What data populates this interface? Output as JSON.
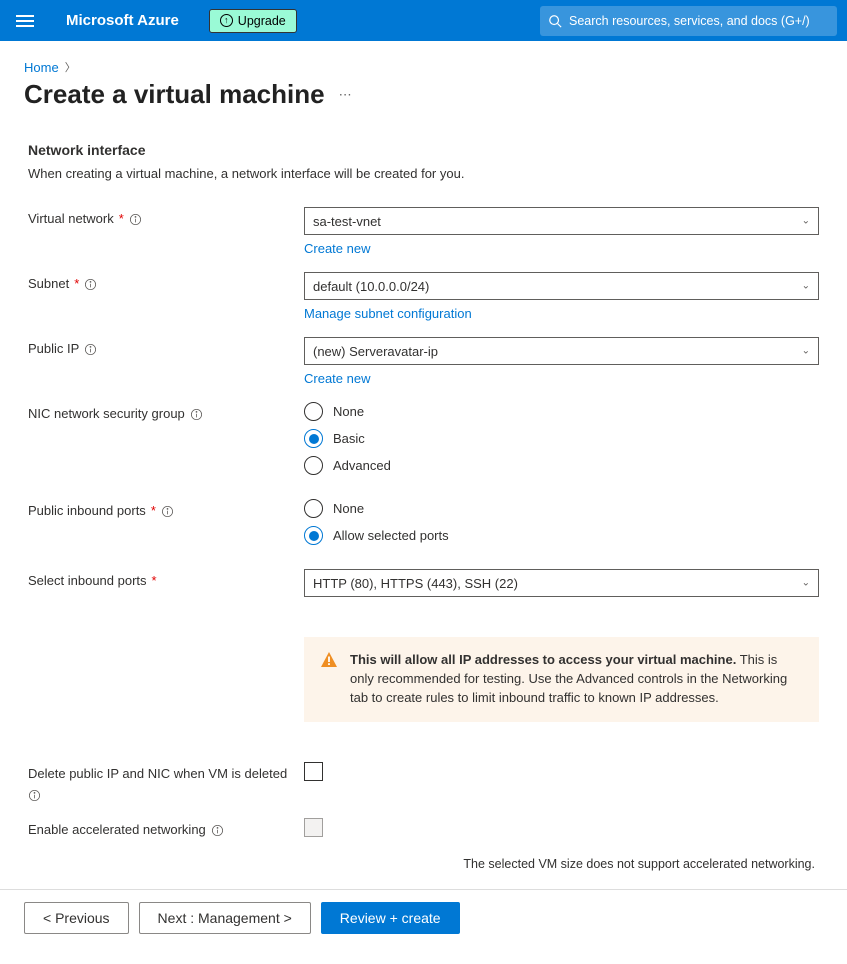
{
  "topbar": {
    "brand": "Microsoft Azure",
    "upgrade_label": "Upgrade",
    "search_placeholder": "Search resources, services, and docs (G+/)"
  },
  "breadcrumb": {
    "home": "Home"
  },
  "page": {
    "title": "Create a virtual machine",
    "ellipsis": "⋯"
  },
  "section": {
    "heading": "Network interface",
    "sub": "When creating a virtual machine, a network interface will be created for you."
  },
  "fields": {
    "vnet_label": "Virtual network",
    "vnet_value": "sa-test-vnet",
    "vnet_link": "Create new",
    "subnet_label": "Subnet",
    "subnet_value": "default (10.0.0.0/24)",
    "subnet_link": "Manage subnet configuration",
    "public_ip_label": "Public IP",
    "public_ip_value": "(new) Serveravatar-ip",
    "public_ip_link": "Create new",
    "nsg_label": "NIC network security group",
    "nsg_options": [
      {
        "label": "None",
        "selected": false
      },
      {
        "label": "Basic",
        "selected": true
      },
      {
        "label": "Advanced",
        "selected": false
      }
    ],
    "inbound_label": "Public inbound ports",
    "inbound_options": [
      {
        "label": "None",
        "selected": false
      },
      {
        "label": "Allow selected ports",
        "selected": true
      }
    ],
    "select_ports_label": "Select inbound ports",
    "select_ports_value": "HTTP (80), HTTPS (443), SSH (22)",
    "delete_ip_label": "Delete public IP and NIC when VM is deleted",
    "accel_label": "Enable accelerated networking",
    "accel_help": "The selected VM size does not support accelerated networking."
  },
  "alert": {
    "bold": "This will allow all IP addresses to access your virtual machine.",
    "body": "  This is only recommended for testing.  Use the Advanced controls in the Networking tab to create rules to limit inbound traffic to known IP addresses."
  },
  "footer": {
    "previous": "< Previous",
    "next": "Next : Management >",
    "review": "Review + create"
  }
}
